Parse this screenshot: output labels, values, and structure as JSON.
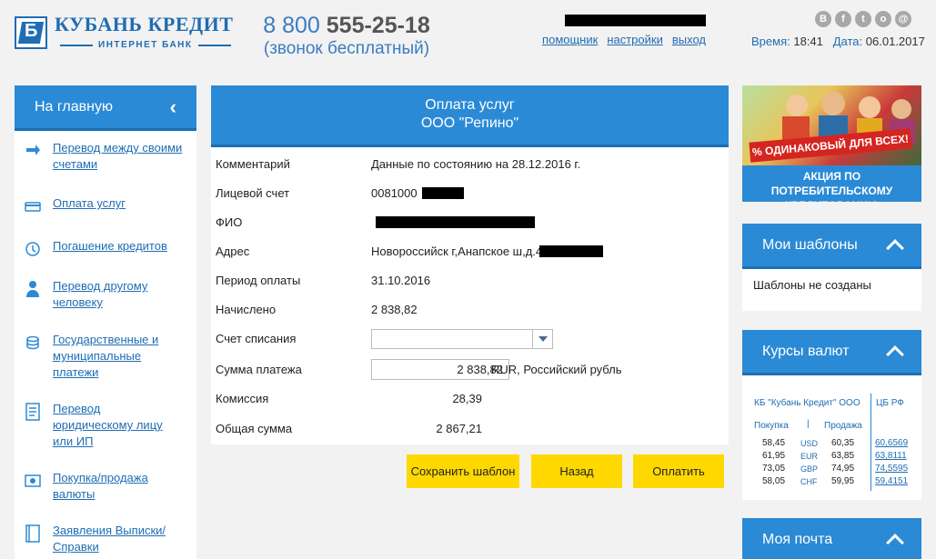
{
  "header": {
    "bank_name": "КУБАНЬ КРЕДИТ",
    "bank_sub": "ИНТЕРНЕТ БАНК",
    "phone_prefix": "8 800",
    "phone_main": "555-25-18",
    "phone_note": "(звонок бесплатный)",
    "user_links": [
      "помощник",
      "настройки",
      "выход"
    ],
    "social_icons": [
      "vk-icon",
      "facebook-icon",
      "twitter-icon",
      "odnoklassniki-icon",
      "mailru-icon"
    ],
    "time_label": "Время:",
    "time_value": "18:41",
    "date_label": "Дата:",
    "date_value": "06.01.2017"
  },
  "sidebar": {
    "title": "На главную",
    "items": [
      {
        "label": "Перевод между своими счетами",
        "icon": "transfer-icon"
      },
      {
        "label": "Оплата услуг",
        "icon": "payment-icon"
      },
      {
        "label": "Погашение кредитов",
        "icon": "credit-icon"
      },
      {
        "label": "Перевод другому человеку",
        "icon": "person-icon"
      },
      {
        "label": "Государственные и муниципальные платежи",
        "icon": "coins-icon"
      },
      {
        "label": "Перевод юридическому лицу или ИП",
        "icon": "document-icon"
      },
      {
        "label": "Покупка/продажа валюты",
        "icon": "currency-icon"
      },
      {
        "label": "Заявления Выписки/ Справки",
        "icon": "book-icon"
      }
    ]
  },
  "main": {
    "title": "Оплата услуг",
    "subtitle": "ООО \"Репино\"",
    "rows": {
      "comment_label": "Комментарий",
      "comment_value": "Данные по состоянию на 28.12.2016 г.",
      "account_label": "Лицевой счет",
      "account_value": "0081000",
      "fio_label": "ФИО",
      "address_label": "Адрес",
      "address_value": "Новороссийск г,Анапское ш,д.4",
      "period_label": "Период оплаты",
      "period_value": "31.10.2016",
      "accrued_label": "Начислено",
      "accrued_value": "2 838,82",
      "debit_label": "Счет списания",
      "amount_label": "Сумма платежа",
      "amount_value": "2 838,82",
      "currency": "RUR, Российский рубль",
      "fee_label": "Комиссия",
      "fee_value": "28,39",
      "total_label": "Общая сумма",
      "total_value": "2 867,21"
    },
    "buttons": {
      "save_template": "Сохранить шаблон",
      "back": "Назад",
      "pay": "Оплатить"
    }
  },
  "promo": {
    "ribbon": "% ОДИНАКОВЫЙ ДЛЯ ВСЕХ!",
    "text": "АКЦИЯ ПО ПОТРЕБИТЕЛЬСКОМУ КРЕДИТОВАНИЮ"
  },
  "templates_widget": {
    "title": "Мои шаблоны",
    "empty": "Шаблоны не созданы"
  },
  "rates_widget": {
    "title": "Курсы валют",
    "bank_label": "КБ \"Кубань Кредит\" ООО",
    "cb_label": "ЦБ РФ",
    "buy_label": "Покупка",
    "sell_label": "Продажа",
    "rows": [
      {
        "buy": "58,45",
        "cur": "USD",
        "sell": "60,35",
        "cb": "60,6569"
      },
      {
        "buy": "61,95",
        "cur": "EUR",
        "sell": "63,85",
        "cb": "63,8111"
      },
      {
        "buy": "73,05",
        "cur": "GBP",
        "sell": "74,95",
        "cb": "74,5595"
      },
      {
        "buy": "58,05",
        "cur": "CHF",
        "sell": "59,95",
        "cb": "59,4151"
      }
    ]
  },
  "mail_widget": {
    "title": "Моя почта"
  },
  "colors": {
    "primary_blue": "#2b8ad6",
    "link_blue": "#1f6db3",
    "button_yellow": "#ffd800"
  }
}
